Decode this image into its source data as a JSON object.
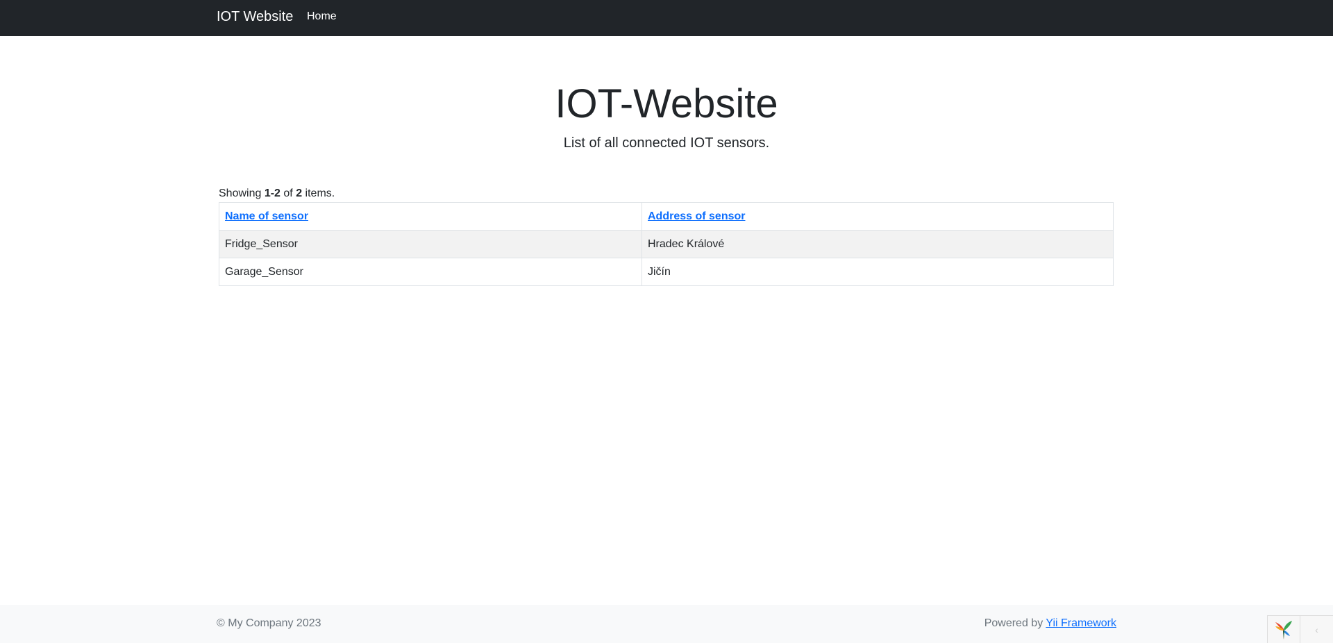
{
  "navbar": {
    "brand": "IOT Website",
    "links": [
      {
        "label": "Home"
      }
    ]
  },
  "hero": {
    "title": "IOT-Website",
    "lead": "List of all connected IOT sensors."
  },
  "grid": {
    "summary": {
      "prefix": "Showing ",
      "range": "1-2",
      "of": " of ",
      "total": "2",
      "suffix": " items."
    },
    "columns": [
      "Name of sensor",
      "Address of sensor"
    ],
    "rows": [
      [
        "Fridge_Sensor",
        "Hradec Králové"
      ],
      [
        "Garage_Sensor",
        "Jičín"
      ]
    ]
  },
  "footer": {
    "copyright": "© My Company 2023",
    "powered_prefix": "Powered by ",
    "powered_link": "Yii Framework"
  },
  "debug_toolbar": {
    "logo_icon": "yii-logo-icon",
    "toggle_icon": "chevron-left-icon",
    "toggle_glyph": "‹"
  }
}
